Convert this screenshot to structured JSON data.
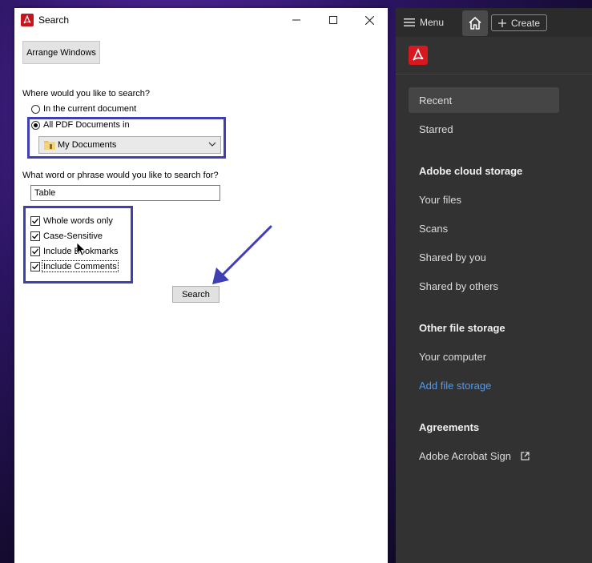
{
  "dialog": {
    "title": "Search",
    "arrange_label": "Arrange Windows",
    "where_prompt": "Where would you like to search?",
    "option_current": "In the current document",
    "option_all": "All PDF Documents in",
    "location_value": "My Documents",
    "phrase_prompt": "What word or phrase would you like to search for?",
    "phrase_value": "Table",
    "checkboxes": [
      {
        "label": "Whole words only",
        "checked": true
      },
      {
        "label": "Case-Sensitive",
        "checked": true
      },
      {
        "label": "Include Bookmarks",
        "checked": true
      },
      {
        "label": "Include Comments",
        "checked": true
      }
    ],
    "search_label": "Search"
  },
  "acrobat": {
    "menu_label": "Menu",
    "create_label": "Create",
    "nav": {
      "recent": "Recent",
      "starred": "Starred",
      "cloud_heading": "Adobe cloud storage",
      "your_files": "Your files",
      "scans": "Scans",
      "shared_by_you": "Shared by you",
      "shared_by_others": "Shared by others",
      "other_heading": "Other file storage",
      "your_computer": "Your computer",
      "add_storage": "Add file storage",
      "agreements_heading": "Agreements",
      "acrobat_sign": "Adobe Acrobat Sign"
    }
  },
  "colors": {
    "highlight": "#3d3fb3",
    "acrobat_red": "#d7191f",
    "panel_bg": "#323232",
    "link": "#4d9cf7"
  }
}
